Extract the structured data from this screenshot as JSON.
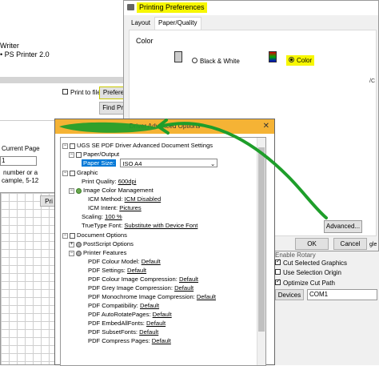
{
  "bg_window": {
    "printer_name": "Writer",
    "printer_sub": "• PS Printer 2.0",
    "print_to_file_label": "Print to file",
    "preferences_button": "Prefere",
    "find_printer_button": "Find Pri",
    "page_range": {
      "current_page_label": "Current Page",
      "value": "1",
      "help_line1": "number or a",
      "help_line2": "cample, 5-12"
    },
    "print_button_fragment": "Pri",
    "right_edge_fragment": "/C"
  },
  "printing_preferences": {
    "title": "Printing Preferences",
    "tabs": [
      {
        "label": "Layout"
      },
      {
        "label": "Paper/Quality"
      }
    ],
    "color_group_label": "Color",
    "bw_label": "Black & White",
    "color_label": "Color",
    "advanced_button": "Advanced...",
    "ok_button": "OK",
    "cancel_button": "Cancel"
  },
  "driver_advanced": {
    "title": "Driver Advanced Options",
    "root": "UGS SE PDF Driver Advanced Document Settings",
    "paper_output": "Paper/Output",
    "paper_size_label": "Paper Size:",
    "paper_size_value": "ISO A4",
    "graphic": "Graphic",
    "print_quality_label": "Print Quality:",
    "print_quality_value": "600dpi",
    "image_color_management": "Image Color Management",
    "icm_method_label": "ICM Method:",
    "icm_method_value": "ICM Disabled",
    "icm_intent_label": "ICM Intent:",
    "icm_intent_value": "Pictures",
    "scaling_label": "Scaling:",
    "scaling_value": "100 %",
    "truetype_label": "TrueType Font:",
    "truetype_value": "Substitute with Device Font",
    "document_options": "Document Options",
    "postscript_options": "PostScript Options",
    "printer_features": "Printer Features",
    "features": [
      {
        "label": "PDF Colour Model:",
        "value": "Default"
      },
      {
        "label": "PDF Settings:",
        "value": "Default"
      },
      {
        "label": "PDF Colour Image Compression:",
        "value": "Default"
      },
      {
        "label": "PDF Grey Image Compression:",
        "value": "Default"
      },
      {
        "label": "PDF Monochrome Image Compression:",
        "value": "Default"
      },
      {
        "label": "PDF Compatibility:",
        "value": "Default"
      },
      {
        "label": "PDF AutoRotatePages:",
        "value": "Default"
      },
      {
        "label": "PDF EmbedAllFonts:",
        "value": "Default"
      },
      {
        "label": "PDF SubsetFonts:",
        "value": "Default"
      },
      {
        "label": "PDF Compress Pages:",
        "value": "Default"
      }
    ]
  },
  "right_panel": {
    "enable_rotary": "Enable Rotary",
    "cut_selected_graphics": "Cut Selected Graphics",
    "use_selection_origin": "Use Selection Origin",
    "optimize_cut_path": "Optimize Cut Path",
    "devices_button": "Devices",
    "port_value": "COM1",
    "edge_fragment": "gle"
  },
  "colors": {
    "highlight": "#f7f700",
    "dialog_title_bar": "#f5b335",
    "annotation_green": "#1e9e2a",
    "selection_blue": "#0078d7"
  }
}
